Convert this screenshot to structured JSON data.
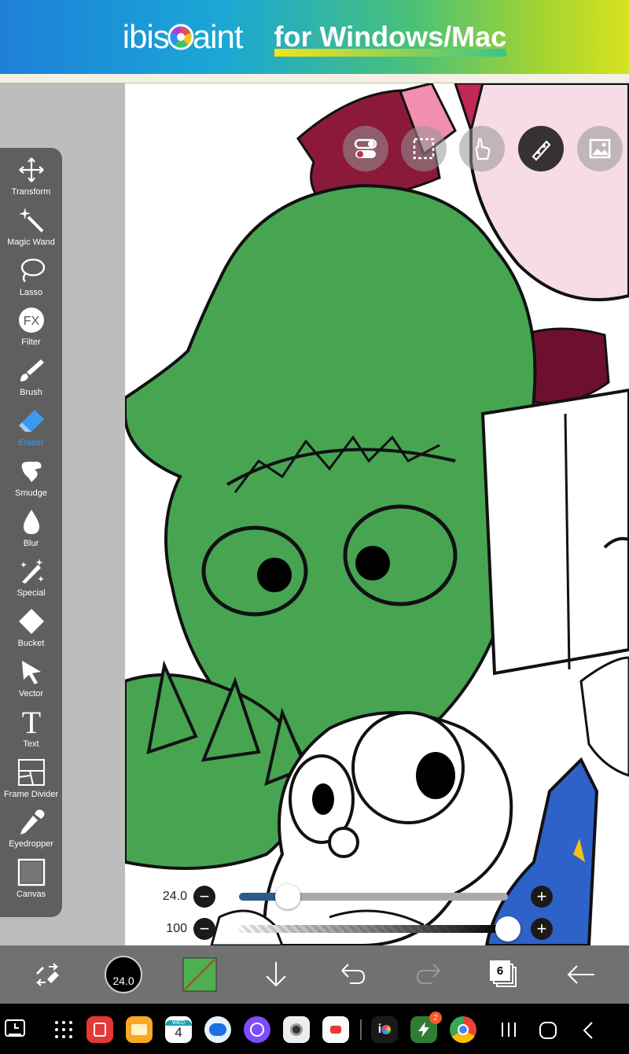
{
  "banner": {
    "brand_left": "ibis",
    "brand_right": "aint",
    "tagline": "for Windows/Mac"
  },
  "tools": [
    {
      "id": "transform",
      "label": "Transform",
      "icon": "transform-arrows-icon"
    },
    {
      "id": "magic-wand",
      "label": "Magic Wand",
      "icon": "magic-wand-icon"
    },
    {
      "id": "lasso",
      "label": "Lasso",
      "icon": "lasso-icon"
    },
    {
      "id": "filter",
      "label": "Filter",
      "icon": "fx-icon",
      "icon_text": "FX"
    },
    {
      "id": "brush",
      "label": "Brush",
      "icon": "brush-icon"
    },
    {
      "id": "eraser",
      "label": "Eraser",
      "icon": "eraser-icon",
      "active": true
    },
    {
      "id": "smudge",
      "label": "Smudge",
      "icon": "smudge-finger-icon"
    },
    {
      "id": "blur",
      "label": "Blur",
      "icon": "droplet-icon"
    },
    {
      "id": "special",
      "label": "Special",
      "icon": "sparkle-pen-icon"
    },
    {
      "id": "bucket",
      "label": "Bucket",
      "icon": "bucket-icon"
    },
    {
      "id": "vector",
      "label": "Vector",
      "icon": "cursor-arrow-icon"
    },
    {
      "id": "text",
      "label": "Text",
      "icon": "text-t-icon",
      "icon_text": "T"
    },
    {
      "id": "frame-divider",
      "label": "Frame Divider",
      "icon": "frame-divider-icon"
    },
    {
      "id": "eyedropper",
      "label": "Eyedropper",
      "icon": "eyedropper-icon"
    },
    {
      "id": "canvas",
      "label": "Canvas",
      "icon": "canvas-square-icon"
    }
  ],
  "sliders": {
    "size": {
      "value_label": "24.0",
      "fraction": 0.18
    },
    "opacity": {
      "value_label": "100",
      "fraction": 1.0
    }
  },
  "bottombar": {
    "brush_size_label": "24.0",
    "layer_count": "6",
    "secondary_color": "#4caf50"
  },
  "taskbar": {
    "calendar_day": "WED",
    "calendar_date": "4",
    "notification_badge": "2"
  },
  "colors": {
    "accent": "#3b9af0",
    "panel": "#5f5f5f",
    "art_green": "#47a552",
    "art_maroon": "#8b1a3a",
    "art_pink": "#f7dbe6",
    "art_blue": "#2f62c8"
  }
}
